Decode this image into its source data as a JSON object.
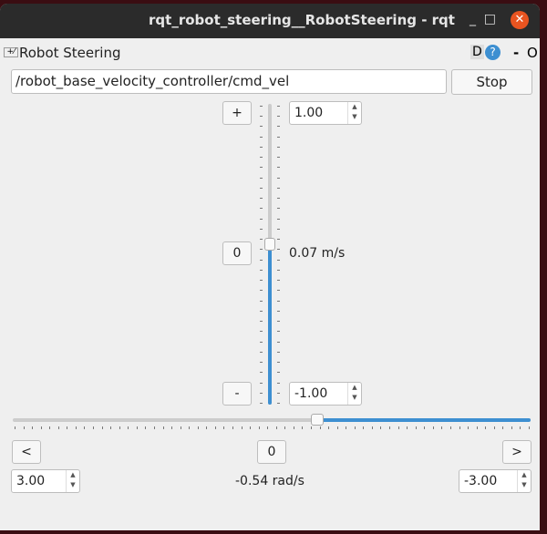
{
  "window": {
    "title": "rqt_robot_steering__RobotSteering - rqt",
    "minimize": "_",
    "maximize": "□",
    "close": "✕"
  },
  "plugin": {
    "title": "Robot Steering",
    "d_label": "D",
    "help": "?",
    "minus": "-",
    "o": "O"
  },
  "topic": {
    "value": "/robot_base_velocity_controller/cmd_vel",
    "stop_label": "Stop"
  },
  "linear": {
    "plus": "+",
    "zero": "0",
    "minus": "-",
    "max": "1.00",
    "min": "-1.00",
    "readout": "0.07 m/s",
    "value": 0.07,
    "range": [
      -1,
      1
    ]
  },
  "angular": {
    "left": "<",
    "zero": "0",
    "right": ">",
    "left_limit": "3.00",
    "right_limit": "-3.00",
    "readout": "-0.54 rad/s",
    "value": -0.54,
    "range": [
      3,
      -3
    ]
  },
  "colors": {
    "accent": "#3d8fd1",
    "close": "#e95420"
  }
}
